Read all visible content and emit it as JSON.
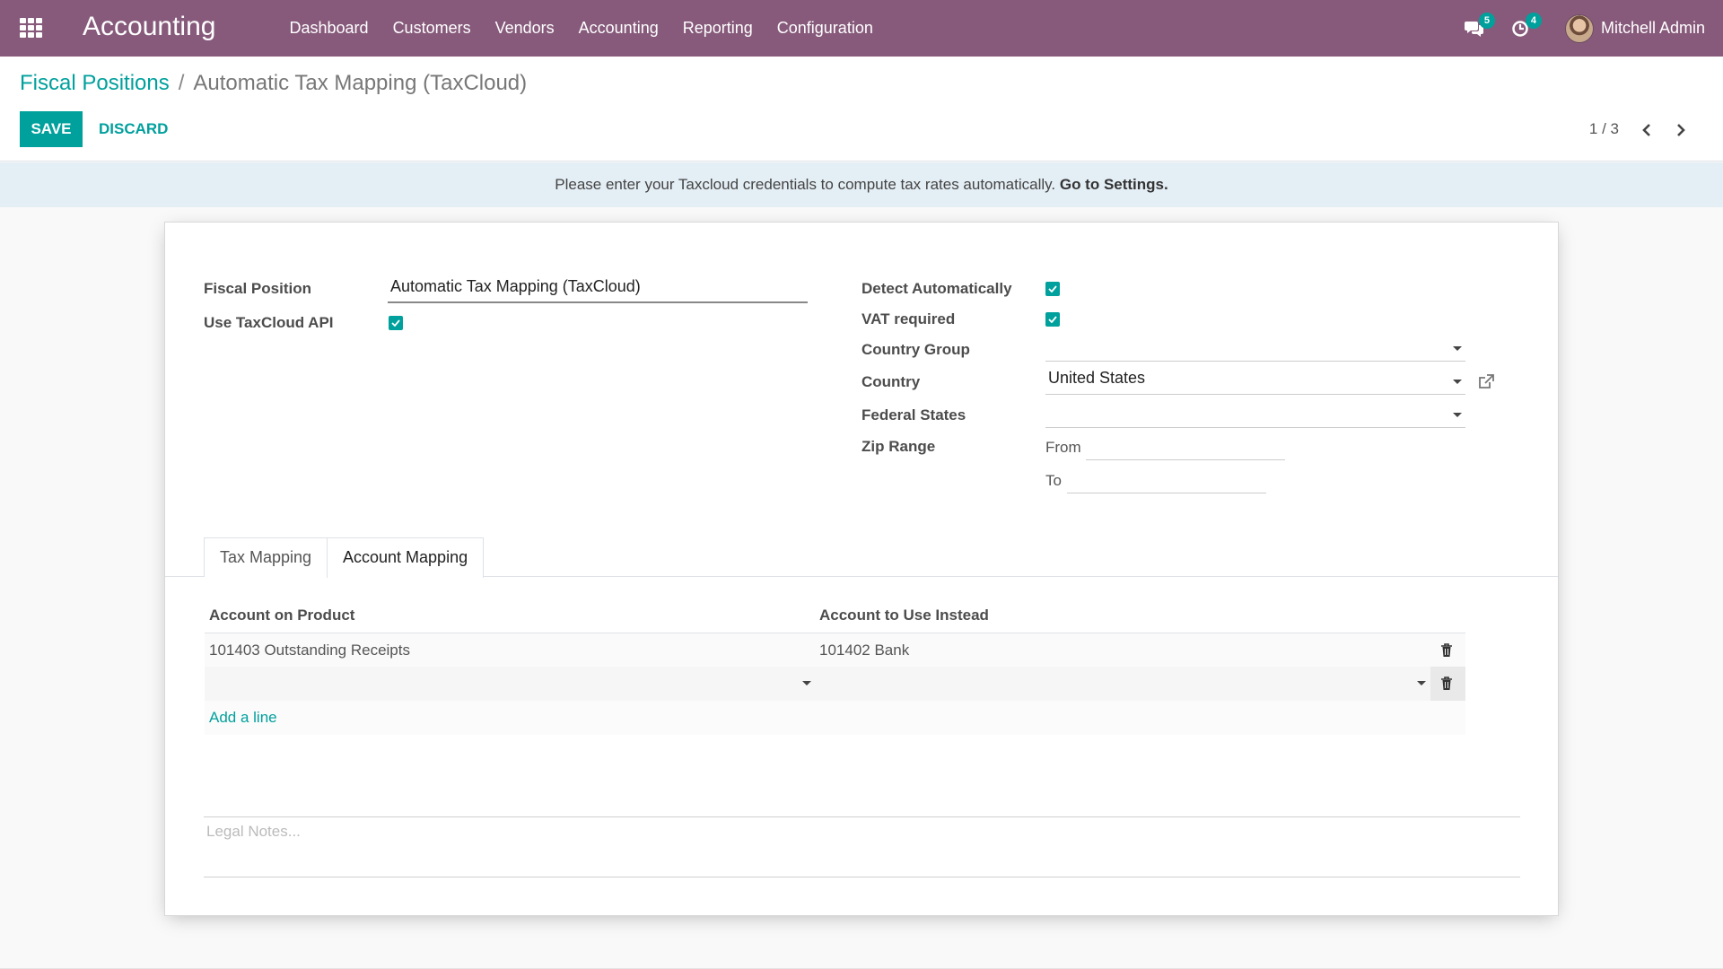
{
  "navbar": {
    "app_name": "Accounting",
    "menu": [
      "Dashboard",
      "Customers",
      "Vendors",
      "Accounting",
      "Reporting",
      "Configuration"
    ],
    "messages_count": "5",
    "activities_count": "4",
    "user_name": "Mitchell Admin",
    "bg_color": "#875a7b"
  },
  "breadcrumb": {
    "parent": "Fiscal Positions",
    "separator": "/",
    "current": "Automatic Tax Mapping (TaxCloud)"
  },
  "actions": {
    "save_label": "SAVE",
    "discard_label": "DISCARD"
  },
  "pager": {
    "value": "1 / 3"
  },
  "alert": {
    "text": "Please enter your Taxcloud credentials to compute tax rates automatically.",
    "link": "Go to Settings."
  },
  "form": {
    "fiscal_position_label": "Fiscal Position",
    "fiscal_position_value": "Automatic Tax Mapping (TaxCloud)",
    "use_taxcloud_label": "Use TaxCloud API",
    "use_taxcloud_checked": true,
    "detect_auto_label": "Detect Automatically",
    "detect_auto_checked": true,
    "vat_required_label": "VAT required",
    "vat_required_checked": true,
    "country_group_label": "Country Group",
    "country_group_value": "",
    "country_label": "Country",
    "country_value": "United States",
    "federal_states_label": "Federal States",
    "federal_states_value": "",
    "zip_range_label": "Zip Range",
    "zip_from_label": "From",
    "zip_from_value": "",
    "zip_to_label": "To",
    "zip_to_value": ""
  },
  "tabs": [
    {
      "label": "Tax Mapping",
      "active": false
    },
    {
      "label": "Account Mapping",
      "active": true
    }
  ],
  "account_mapping": {
    "columns": [
      "Account on Product",
      "Account to Use Instead"
    ],
    "rows": [
      {
        "src": "101403 Outstanding Receipts",
        "dest": "101402 Bank"
      }
    ],
    "add_line_label": "Add a line"
  },
  "notes": {
    "placeholder": "Legal Notes..."
  },
  "colors": {
    "primary": "#00a09d",
    "alert_bg": "#e4eef5"
  }
}
